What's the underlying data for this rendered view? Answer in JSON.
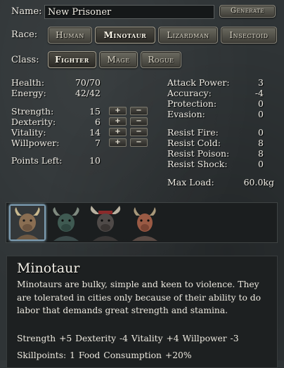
{
  "name": {
    "label": "Name:",
    "value": "New Prisoner",
    "generate_label": "Generate"
  },
  "race": {
    "label": "Race:",
    "options": [
      "Human",
      "Minotaur",
      "Lizardman",
      "Insectoid"
    ],
    "selected": "Minotaur"
  },
  "class": {
    "label": "Class:",
    "options": [
      "Fighter",
      "Mage",
      "Rogue"
    ],
    "selected": "Fighter"
  },
  "vitals": [
    {
      "label": "Health:",
      "value": "70/70"
    },
    {
      "label": "Energy:",
      "value": "42/42"
    }
  ],
  "attributes": [
    {
      "label": "Strength:",
      "value": "15"
    },
    {
      "label": "Dexterity:",
      "value": "6"
    },
    {
      "label": "Vitality:",
      "value": "14"
    },
    {
      "label": "Willpower:",
      "value": "7"
    }
  ],
  "attr_buttons": {
    "plus": "+",
    "minus": "−"
  },
  "points_left": {
    "label": "Points Left:",
    "value": "10"
  },
  "combat": [
    {
      "label": "Attack Power:",
      "value": "3"
    },
    {
      "label": "Accuracy:",
      "value": "-4"
    },
    {
      "label": "Protection:",
      "value": "0"
    },
    {
      "label": "Evasion:",
      "value": "0"
    }
  ],
  "resists": [
    {
      "label": "Resist Fire:",
      "value": "0"
    },
    {
      "label": "Resist Cold:",
      "value": "8"
    },
    {
      "label": "Resist Poison:",
      "value": "8"
    },
    {
      "label": "Resist Shock:",
      "value": "0"
    }
  ],
  "max_load": {
    "label": "Max Load:",
    "value": "60.0kg"
  },
  "portraits": [
    "minotaur-portrait-1",
    "minotaur-portrait-2",
    "minotaur-portrait-3",
    "minotaur-portrait-4"
  ],
  "description": {
    "title": "Minotaur",
    "body": "Minotaurs are bulky, simple and keen to violence. They are tolerated in cities only because of their ability to do labor that demands great strength and stamina.",
    "modifiers": "Strength +5  Dexterity -4  Vitality +4  Willpower -3",
    "extras": "Skillpoints: 1  Food Consumption +20%"
  },
  "colors": {
    "background": "#2f3436",
    "panel": "#1d2021",
    "selected_portrait": "#7b9bb0"
  }
}
